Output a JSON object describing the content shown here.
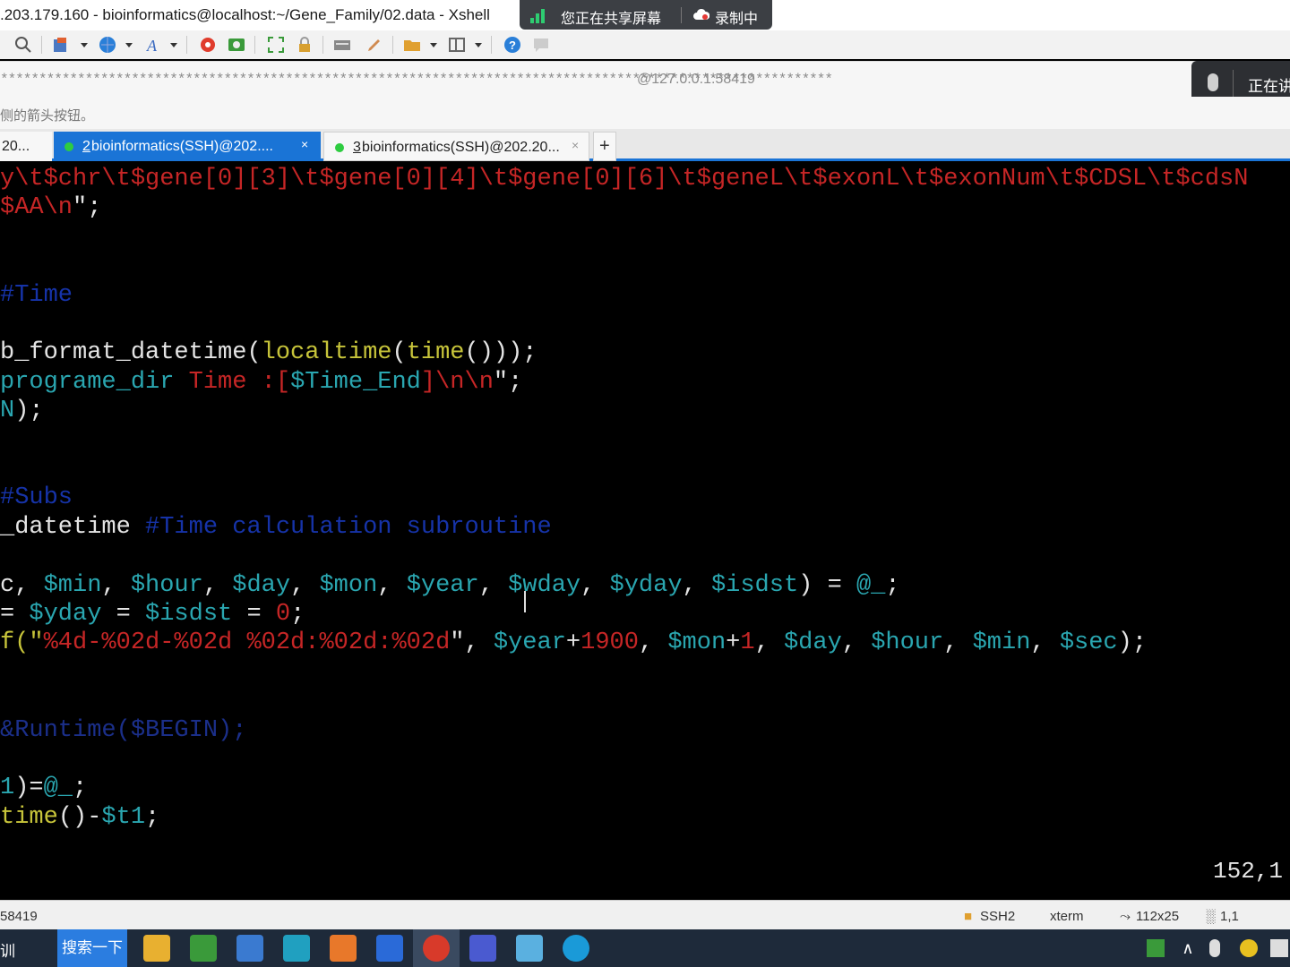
{
  "window": {
    "title": ".203.179.160 - bioinformatics@localhost:~/Gene_Family/02.data - Xshell"
  },
  "share_banner": {
    "share_text": "您正在共享屏幕",
    "record_text": "录制中"
  },
  "toolbar": {
    "icons": [
      "search-icon",
      "new-session-icon",
      "globe-icon",
      "font-icon",
      "xftp-icon",
      "green-app-icon",
      "fullscreen-icon",
      "lock-icon",
      "keyboard-icon",
      "pen-icon",
      "folder-icon",
      "layout-icon",
      "help-icon",
      "chat-icon"
    ]
  },
  "address": {
    "masked": "************************************************************************************************************",
    "host": "@127.0.0.1:58419"
  },
  "mic_popup": {
    "text": "正在讲"
  },
  "hint": {
    "text": "侧的箭头按钮。"
  },
  "tabs": [
    {
      "label": "20...",
      "active": false
    },
    {
      "number": "2",
      "label": " bioinformatics(SSH)@202....",
      "active": true,
      "close": "×"
    },
    {
      "number": "3",
      "label": " bioinformatics(SSH)@202.20...",
      "active": false,
      "close": "×"
    }
  ],
  "tab_add": "+",
  "terminal": {
    "lines": [
      {
        "segments": [
          {
            "t": "y\\t$chr\\t$gene",
            "c": "r"
          },
          {
            "t": "[0][3]",
            "c": "r"
          },
          {
            "t": "\\t$gene",
            "c": "r"
          },
          {
            "t": "[0][4]",
            "c": "r"
          },
          {
            "t": "\\t$gene",
            "c": "r"
          },
          {
            "t": "[0][6]",
            "c": "r"
          },
          {
            "t": "\\t$geneL\\t$exonL\\t$exonNum\\t$CDSL\\t$cdsN",
            "c": "r"
          }
        ]
      },
      {
        "segments": [
          {
            "t": "$AA\\n",
            "c": "r"
          },
          {
            "t": "\";",
            "c": "w"
          }
        ]
      },
      {
        "segments": []
      },
      {
        "segments": []
      },
      {
        "segments": [
          {
            "t": "#Time",
            "c": "b"
          }
        ]
      },
      {
        "segments": []
      },
      {
        "segments": [
          {
            "t": "b_format_datetime(",
            "c": "w"
          },
          {
            "t": "localtime",
            "c": "y"
          },
          {
            "t": "(",
            "c": "w"
          },
          {
            "t": "time",
            "c": "y"
          },
          {
            "t": "()));",
            "c": "w"
          }
        ]
      },
      {
        "segments": [
          {
            "t": "programe_dir ",
            "c": "c"
          },
          {
            "t": "Time :[",
            "c": "r"
          },
          {
            "t": "$Time_End",
            "c": "c"
          },
          {
            "t": "]\\n\\n",
            "c": "r"
          },
          {
            "t": "\";",
            "c": "w"
          }
        ]
      },
      {
        "segments": [
          {
            "t": "N",
            "c": "c"
          },
          {
            "t": ");",
            "c": "w"
          }
        ]
      },
      {
        "segments": []
      },
      {
        "segments": []
      },
      {
        "segments": [
          {
            "t": "#Subs",
            "c": "b"
          }
        ]
      },
      {
        "segments": [
          {
            "t": "_datetime ",
            "c": "w"
          },
          {
            "t": "#Time calculation subroutine",
            "c": "b"
          }
        ]
      },
      {
        "segments": []
      },
      {
        "segments": [
          {
            "t": "c, ",
            "c": "w"
          },
          {
            "t": "$min",
            "c": "c"
          },
          {
            "t": ", ",
            "c": "w"
          },
          {
            "t": "$hour",
            "c": "c"
          },
          {
            "t": ", ",
            "c": "w"
          },
          {
            "t": "$day",
            "c": "c"
          },
          {
            "t": ", ",
            "c": "w"
          },
          {
            "t": "$mon",
            "c": "c"
          },
          {
            "t": ", ",
            "c": "w"
          },
          {
            "t": "$year",
            "c": "c"
          },
          {
            "t": ", ",
            "c": "w"
          },
          {
            "t": "$wday",
            "c": "c"
          },
          {
            "t": ", ",
            "c": "w"
          },
          {
            "t": "$yday",
            "c": "c"
          },
          {
            "t": ", ",
            "c": "w"
          },
          {
            "t": "$isdst",
            "c": "c"
          },
          {
            "t": ") = ",
            "c": "w"
          },
          {
            "t": "@_",
            "c": "c"
          },
          {
            "t": ";",
            "c": "w"
          }
        ]
      },
      {
        "segments": [
          {
            "t": "= ",
            "c": "w"
          },
          {
            "t": "$yday",
            "c": "c"
          },
          {
            "t": " = ",
            "c": "w"
          },
          {
            "t": "$isdst",
            "c": "c"
          },
          {
            "t": " = ",
            "c": "w"
          },
          {
            "t": "0",
            "c": "r"
          },
          {
            "t": ";",
            "c": "w"
          }
        ]
      },
      {
        "segments": [
          {
            "t": "f(\"",
            "c": "y"
          },
          {
            "t": "%4d-%02d-%02d %02d:%02d:%02d",
            "c": "r"
          },
          {
            "t": "\", ",
            "c": "w"
          },
          {
            "t": "$year",
            "c": "c"
          },
          {
            "t": "+",
            "c": "w"
          },
          {
            "t": "1900",
            "c": "r"
          },
          {
            "t": ", ",
            "c": "w"
          },
          {
            "t": "$mon",
            "c": "c"
          },
          {
            "t": "+",
            "c": "w"
          },
          {
            "t": "1",
            "c": "r"
          },
          {
            "t": ", ",
            "c": "w"
          },
          {
            "t": "$day",
            "c": "c"
          },
          {
            "t": ", ",
            "c": "w"
          },
          {
            "t": "$hour",
            "c": "c"
          },
          {
            "t": ", ",
            "c": "w"
          },
          {
            "t": "$min",
            "c": "c"
          },
          {
            "t": ", ",
            "c": "w"
          },
          {
            "t": "$sec",
            "c": "c"
          },
          {
            "t": ");",
            "c": "w"
          }
        ]
      },
      {
        "segments": []
      },
      {
        "segments": []
      },
      {
        "segments": [
          {
            "t": "&Runtime($BEGIN);",
            "c": "db"
          }
        ]
      },
      {
        "segments": []
      },
      {
        "segments": [
          {
            "t": "1",
            "c": "c"
          },
          {
            "t": ")=",
            "c": "w"
          },
          {
            "t": "@_",
            "c": "c"
          },
          {
            "t": ";",
            "c": "w"
          }
        ]
      },
      {
        "segments": [
          {
            "t": "time",
            "c": "y"
          },
          {
            "t": "()-",
            "c": "w"
          },
          {
            "t": "$t1",
            "c": "c"
          },
          {
            "t": ";",
            "c": "w"
          }
        ]
      }
    ],
    "cursor_position": "152,1"
  },
  "statusbar": {
    "host": "58419",
    "protocol": "SSH2",
    "term": "xterm",
    "size": "112x25",
    "pos": "1,1"
  },
  "taskbar": {
    "left_text": "训",
    "search_label": "搜索一下",
    "apps": [
      "file-explorer-icon",
      "green-app-icon",
      "network-app-icon",
      "camera-app-icon",
      "orange-app-icon",
      "blue-app-icon",
      "xshell-icon",
      "mountain-app-icon",
      "notepad-icon",
      "edge-icon"
    ]
  }
}
